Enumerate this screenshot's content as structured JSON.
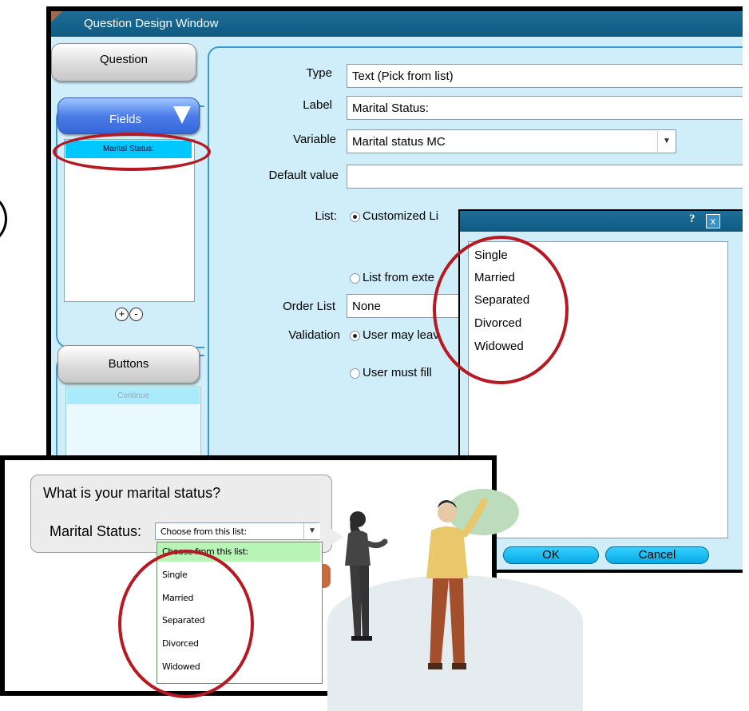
{
  "design_window": {
    "title": "Question Design Window",
    "tabs": {
      "question": "Question",
      "fields": "Fields",
      "buttons": "Buttons"
    },
    "fields_list": [
      "Marital Status:"
    ],
    "fields_add": "+",
    "fields_remove": "-",
    "buttons_list": [
      "Continue"
    ],
    "form": {
      "type_label": "Type",
      "type_value": "Text (Pick from list)",
      "label_label": "Label",
      "label_value": "Marital Status:",
      "variable_label": "Variable",
      "variable_value": "Marital status MC",
      "default_label": "Default value",
      "default_value": "",
      "list_label": "List:",
      "list_customized": "Customized Li",
      "list_external": "List from exte",
      "order_label": "Order List",
      "order_value": "None",
      "validation_label": "Validation",
      "validation_opt1": "User may leav",
      "validation_opt2": "User must fill"
    }
  },
  "list_dialog": {
    "help": "?",
    "close": "x",
    "items": [
      "Single",
      "Married",
      "Separated",
      "Divorced",
      "Widowed"
    ],
    "ok": "OK",
    "cancel": "Cancel"
  },
  "preview": {
    "prompt": "What is your marital status?",
    "field_label": "Marital Status:",
    "select_value": "Choose from this list:",
    "options": [
      "Choose from this list:",
      "Single",
      "Married",
      "Separated",
      "Divorced",
      "Widowed"
    ]
  },
  "colors": {
    "annotation": "#b51922",
    "title_bar": "#0e5a83",
    "window_bg": "#cfeefa",
    "selection": "#00c8ff",
    "dropdown_highlight": "#b7f4b6"
  },
  "icons": {
    "add": "plus-icon",
    "remove": "minus-icon",
    "help": "help-icon",
    "close": "close-icon",
    "dropdown": "chevron-down-icon"
  }
}
